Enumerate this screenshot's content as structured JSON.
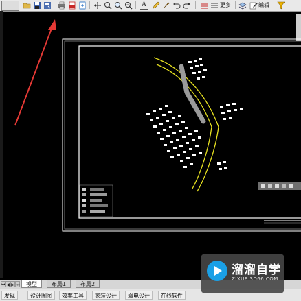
{
  "toolbar": {
    "text_icon": "A",
    "more_label": "更多",
    "edit_label": "编辑"
  },
  "tabs": [
    {
      "label": "模型",
      "active": true
    },
    {
      "label": "布局1",
      "active": false
    },
    {
      "label": "布局2",
      "active": false
    }
  ],
  "statusbar": {
    "items": [
      "发现",
      "设计图图",
      "效率工具",
      "家装设计",
      "弱电设计",
      "在线软件"
    ]
  },
  "watermark": {
    "title": "溜溜自学",
    "url": "ZIXUE.3D66.COM"
  },
  "colors": {
    "accent_arrow": "#e53935",
    "road_yellow": "#e6e020",
    "frame_white": "#ffffff",
    "toolbar_bg": "#e9e9e9"
  },
  "icons": [
    "open-folder-icon",
    "save-icon",
    "save-as-icon",
    "print-icon",
    "pdf-icon",
    "export-icon",
    "pan-icon",
    "zoom-window-icon",
    "zoom-icon",
    "zoom-extents-icon",
    "text-icon",
    "pencil-icon",
    "brush-icon",
    "undo-icon",
    "redo-icon",
    "layers-icon",
    "more-icon",
    "layer-manager-icon",
    "edit-icon",
    "funnel-icon"
  ]
}
